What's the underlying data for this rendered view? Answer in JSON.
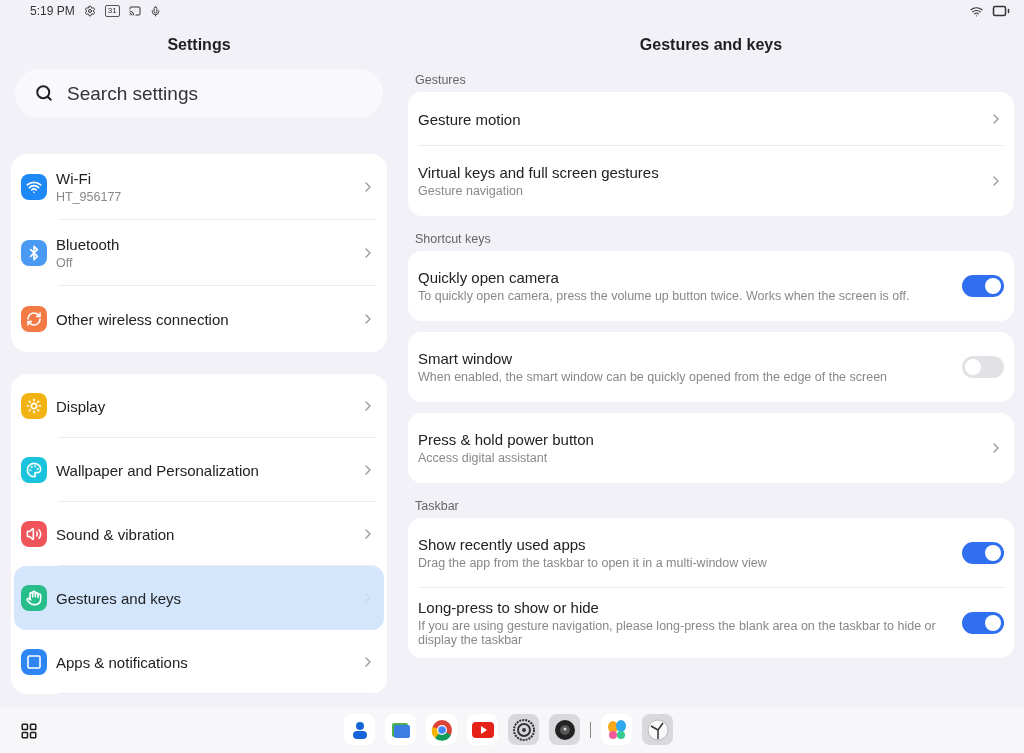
{
  "status_bar": {
    "time": "5:19 PM",
    "calendar_day": "31"
  },
  "sidebar": {
    "title": "Settings",
    "search": {
      "placeholder": "Search settings"
    },
    "groups": [
      {
        "items": [
          {
            "kind": "wifi",
            "color": "#1e88f5",
            "label": "Wi-Fi",
            "sublabel": "HT_956177",
            "selected": false
          },
          {
            "kind": "bluetooth",
            "color": "#4a9af3",
            "label": "Bluetooth",
            "sublabel": "Off",
            "selected": false
          },
          {
            "kind": "wireless",
            "color": "#f47a45",
            "label": "Other wireless connection",
            "selected": false
          }
        ]
      },
      {
        "items": [
          {
            "kind": "display",
            "color": "#f2b312",
            "label": "Display",
            "selected": false
          },
          {
            "kind": "wallpaper",
            "color": "#19c3dc",
            "label": "Wallpaper and Personalization",
            "selected": false
          },
          {
            "kind": "sound",
            "color": "#f0555b",
            "label": "Sound & vibration",
            "selected": false
          },
          {
            "kind": "gestures",
            "color": "#27bd8a",
            "label": "Gestures and keys",
            "selected": true
          },
          {
            "kind": "apps",
            "color": "#2d86f2",
            "label": "Apps & notifications",
            "selected": false
          }
        ]
      }
    ]
  },
  "detail": {
    "title": "Gestures and keys",
    "sections": [
      {
        "header": "Gestures",
        "cards": [
          {
            "rows": [
              {
                "kind": "link",
                "title": "Gesture motion"
              },
              {
                "kind": "link",
                "title": "Virtual keys and full screen gestures",
                "subtitle": "Gesture navigation"
              }
            ]
          }
        ]
      },
      {
        "header": "Shortcut keys",
        "cards": [
          {
            "rows": [
              {
                "kind": "toggle",
                "title": "Quickly open camera",
                "subtitle": "To quickly open camera, press the volume up button twice. Works when the screen is off.",
                "on": true
              }
            ]
          },
          {
            "rows": [
              {
                "kind": "toggle",
                "title": "Smart window",
                "subtitle": "When enabled, the smart window can be quickly opened from the edge of the screen",
                "on": false
              }
            ]
          },
          {
            "rows": [
              {
                "kind": "link",
                "title": "Press & hold power button",
                "subtitle": "Access digital assistant"
              }
            ]
          }
        ]
      },
      {
        "header": "Taskbar",
        "cards": [
          {
            "rows": [
              {
                "kind": "toggle",
                "title": "Show recently used apps",
                "subtitle": "Drag the app from the taskbar to open it in a multi-window view",
                "on": true
              },
              {
                "kind": "toggle",
                "title": "Long-press to show or hide",
                "subtitle": "If you are using gesture navigation, please long-press the blank area on the taskbar to hide or display the taskbar",
                "on": true
              }
            ]
          }
        ]
      }
    ]
  }
}
